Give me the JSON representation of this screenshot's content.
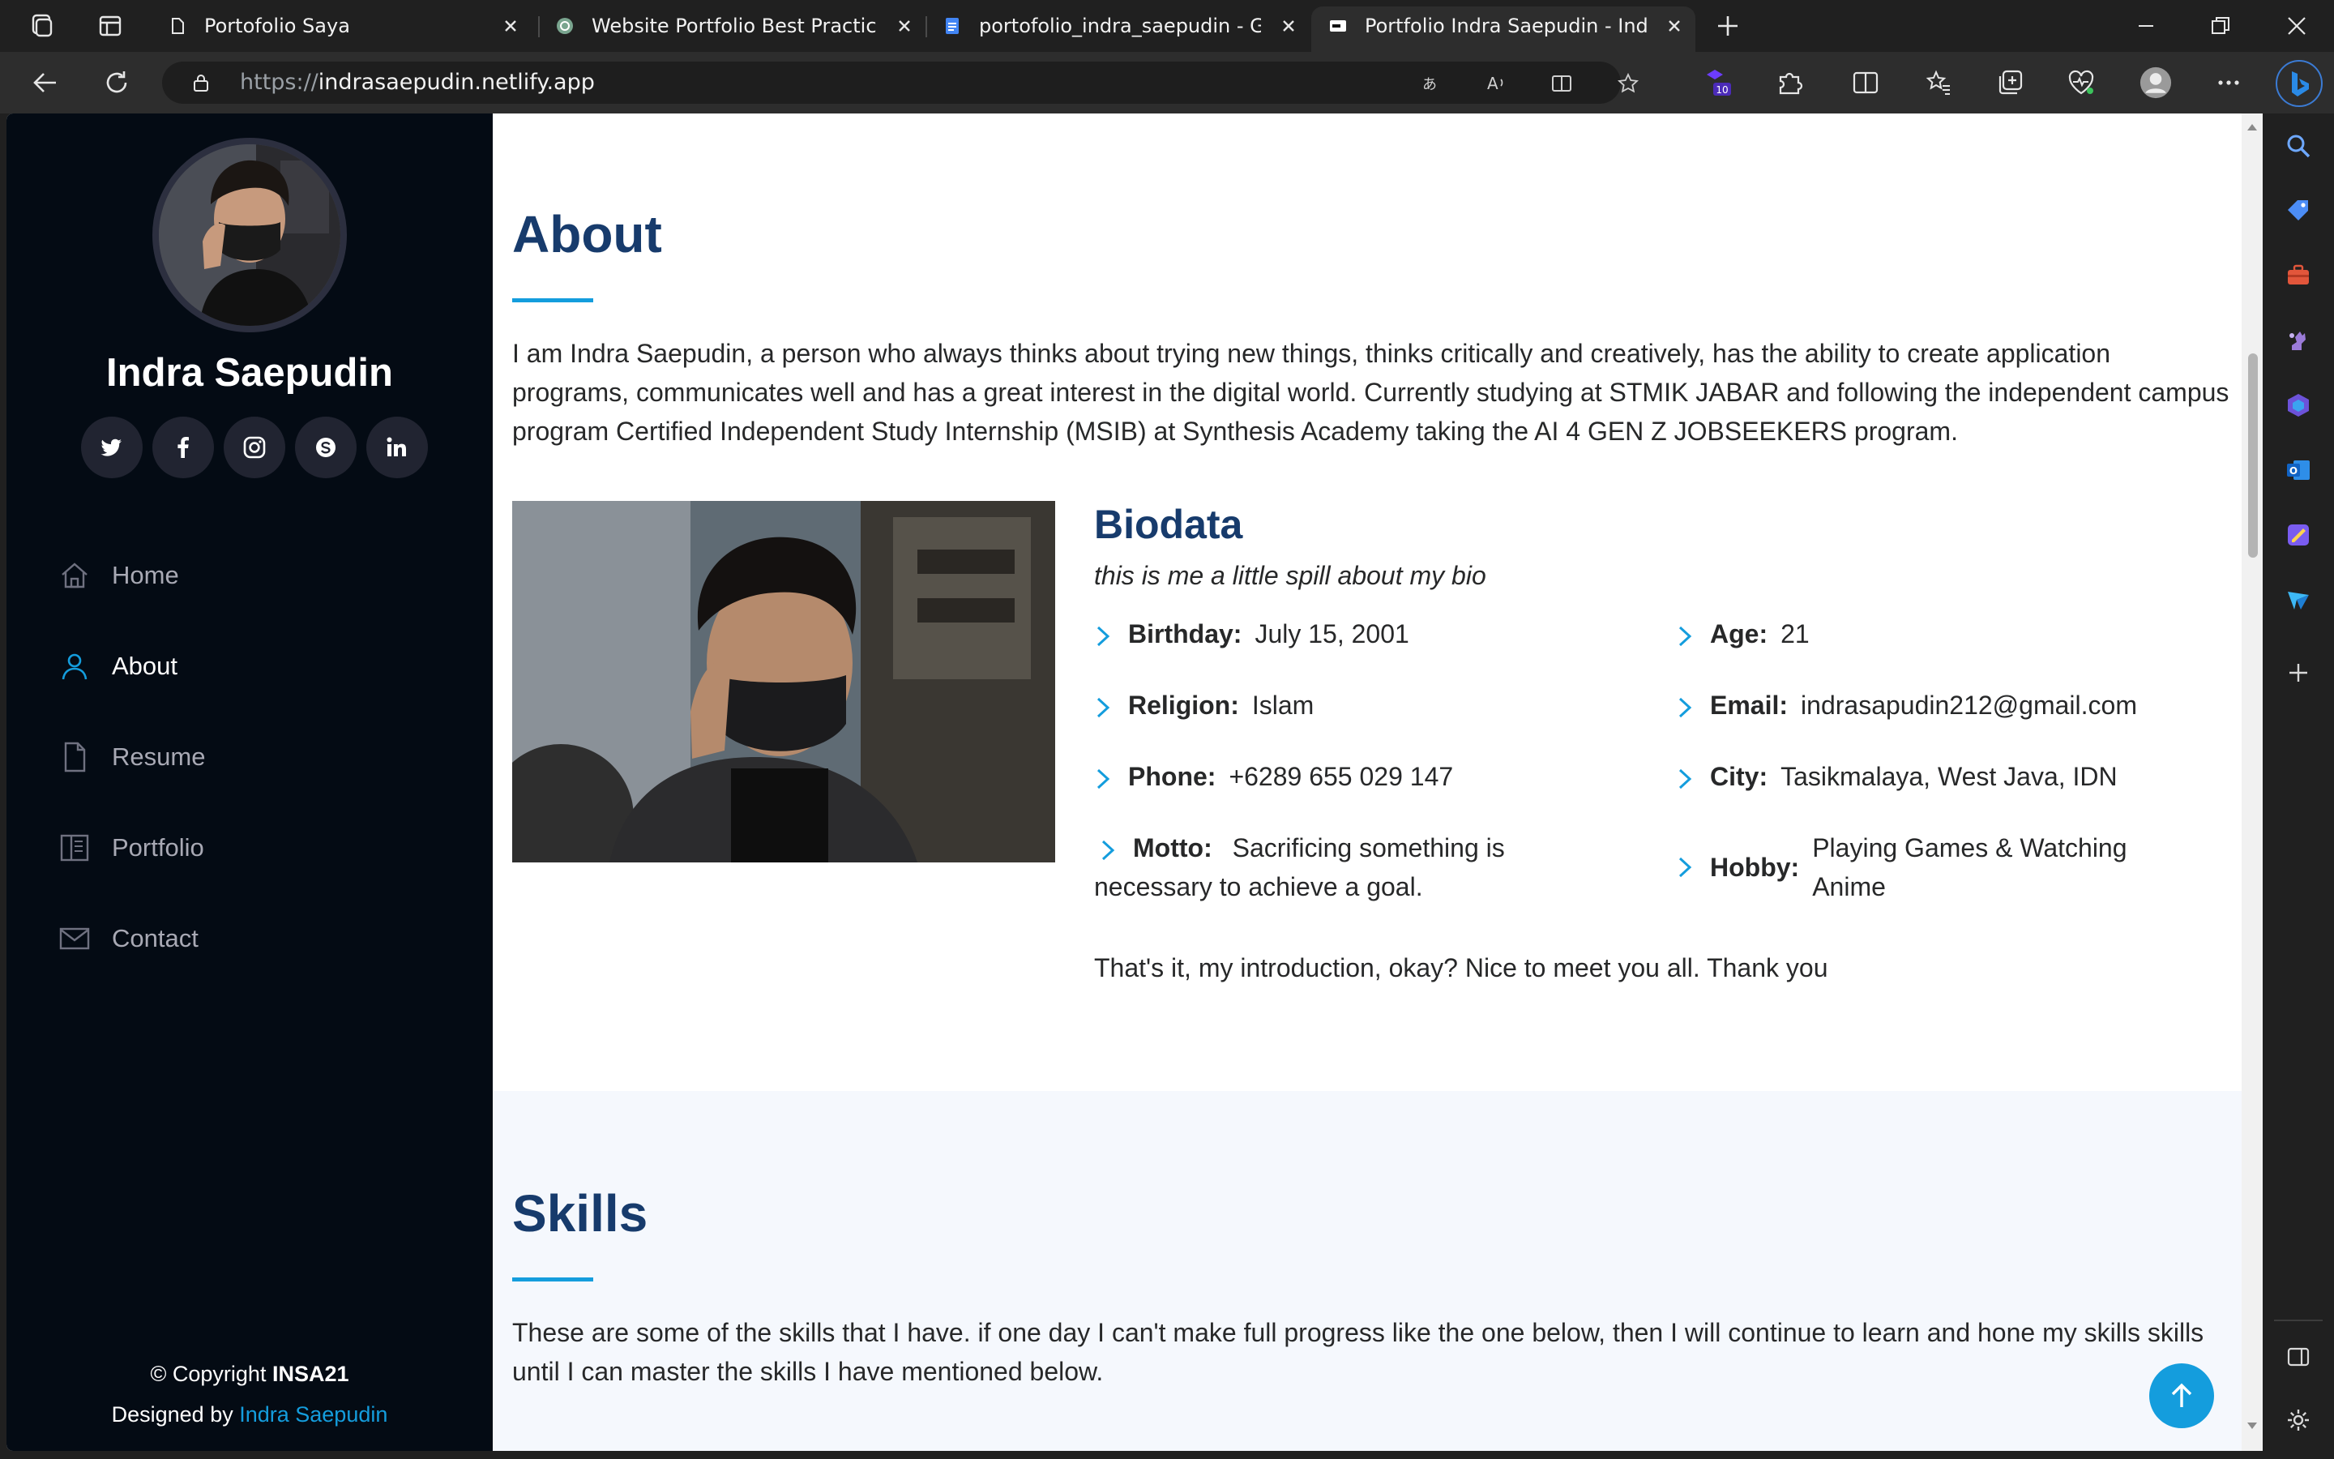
{
  "browser": {
    "tabs": [
      {
        "title": "Portofolio Saya",
        "favicon": "page-icon"
      },
      {
        "title": "Website Portfolio Best Practices",
        "favicon": "chatgpt-icon"
      },
      {
        "title": "portofolio_indra_saepudin - Goo",
        "favicon": "google-docs-icon"
      },
      {
        "title": "Portfolio Indra Saepudin - Index",
        "favicon": "site-icon",
        "active": true
      }
    ],
    "url_prefix": "https://",
    "url_host": "indrasaepudin.netlify.app",
    "extension_badge": "10"
  },
  "site": {
    "name": "Indra Saepudin",
    "social": [
      "twitter-icon",
      "facebook-icon",
      "instagram-icon",
      "skype-icon",
      "linkedin-icon"
    ],
    "nav": [
      {
        "label": "Home",
        "icon": "home-icon"
      },
      {
        "label": "About",
        "icon": "person-icon",
        "active": true
      },
      {
        "label": "Resume",
        "icon": "file-icon"
      },
      {
        "label": "Portfolio",
        "icon": "book-icon"
      },
      {
        "label": "Contact",
        "icon": "envelope-icon"
      }
    ],
    "footer": {
      "copyright_prefix": "© Copyright ",
      "brand": "INSA21",
      "designed_prefix": "Designed by ",
      "designer": "Indra Saepudin"
    }
  },
  "about": {
    "title": "About",
    "text": "I am Indra Saepudin, a person who always thinks about trying new things, thinks critically and creatively, has the ability to create application programs, communicates well and has a great interest in the digital world. Currently studying at STMIK JABAR and following the independent campus program Certified Independent Study Internship (MSIB) at Synthesis Academy taking the AI 4 GEN Z JOBSEEKERS program.",
    "bio_title": "Biodata",
    "bio_subtitle": "this is me a little spill about my bio",
    "bio": {
      "birthday_k": "Birthday:",
      "birthday_v": "July 15, 2001",
      "age_k": "Age:",
      "age_v": "21",
      "religion_k": "Religion:",
      "religion_v": "Islam",
      "email_k": "Email:",
      "email_v": "indrasapudin212@gmail.com",
      "phone_k": "Phone:",
      "phone_v": "+6289 655 029 147",
      "city_k": "City:",
      "city_v": "Tasikmalaya, West Java, IDN",
      "motto_k": "Motto:",
      "motto_v": "Sacrificing something is necessary to achieve a goal.",
      "hobby_k": "Hobby:",
      "hobby_v": "Playing Games & Watching Anime"
    },
    "closing": "That's it, my introduction, okay? Nice to meet you all. Thank you"
  },
  "skills": {
    "title": "Skills",
    "text": "These are some of the skills that I have. if one day I can't make full progress like the one below, then I will continue to learn and hone my skills skills until I can master the skills I have mentioned below."
  },
  "colors": {
    "accent": "#149ddd",
    "heading": "#173b6c",
    "sidebar_bg": "#040b14"
  }
}
